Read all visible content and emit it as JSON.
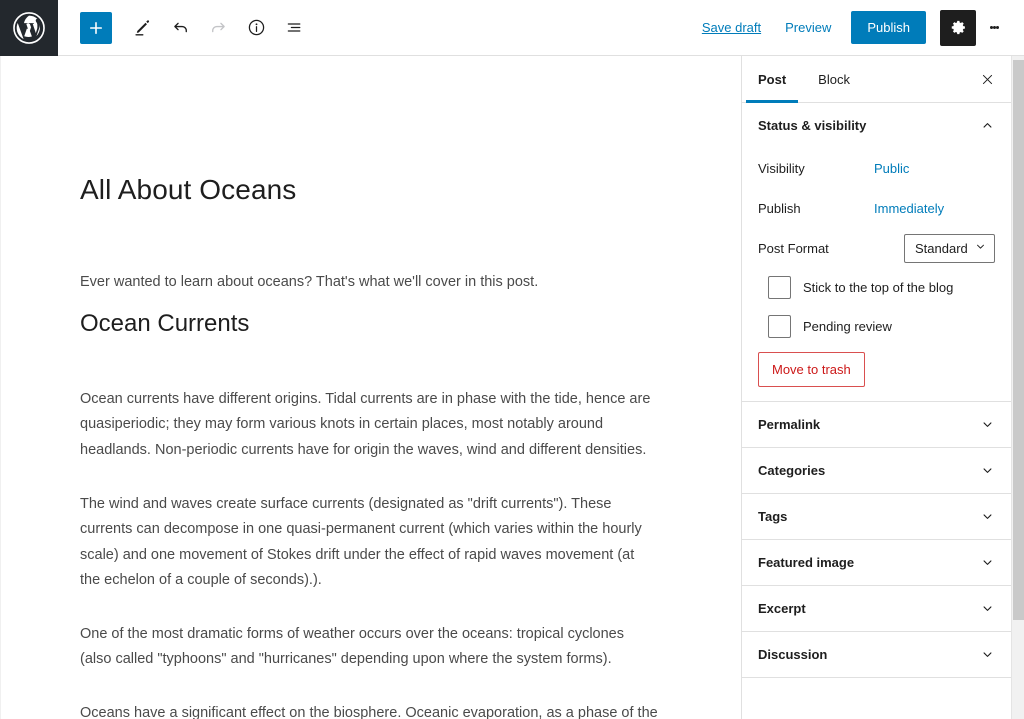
{
  "header": {
    "logo_icon": "wordpress-logo-icon",
    "tools": [
      {
        "name": "add-block-button",
        "icon": "plus-icon",
        "label": "Add block",
        "state": "primary"
      },
      {
        "name": "edit-mode-button",
        "icon": "pencil-icon",
        "label": "Tools",
        "state": "normal"
      },
      {
        "name": "undo-button",
        "icon": "undo-arrow-icon",
        "label": "Undo",
        "state": "normal"
      },
      {
        "name": "redo-button",
        "icon": "redo-arrow-icon",
        "label": "Redo",
        "state": "disabled"
      },
      {
        "name": "details-button",
        "icon": "info-circle-icon",
        "label": "Details",
        "state": "normal"
      },
      {
        "name": "list-view-button",
        "icon": "list-view-icon",
        "label": "List view",
        "state": "normal"
      }
    ],
    "save_draft_label": "Save draft",
    "preview_label": "Preview",
    "publish_label": "Publish",
    "settings_icon": "gear-icon",
    "options_icon": "kebab-menu-icon"
  },
  "editor": {
    "title": "All About Oceans",
    "blocks": [
      {
        "type": "paragraph",
        "text": "Ever wanted to learn about oceans? That's what we'll cover in this post."
      },
      {
        "type": "heading",
        "text": "Ocean Currents"
      },
      {
        "type": "paragraph",
        "text": "Ocean currents have different origins. Tidal currents are in phase with the tide, hence are quasiperiodic; they may form various knots in certain places, most notably around headlands. Non-periodic currents have for origin the waves, wind and different densities."
      },
      {
        "type": "paragraph",
        "text": "The wind and waves create surface currents (designated as \"drift currents\"). These currents can decompose in one quasi-permanent current (which varies within the hourly scale) and one movement of Stokes drift under the effect of rapid waves movement (at the echelon of a couple of seconds).)."
      },
      {
        "type": "paragraph",
        "text": "One of the most dramatic forms of weather occurs over the oceans: tropical cyclones (also called \"typhoons\" and \"hurricanes\" depending upon where the system forms)."
      },
      {
        "type": "paragraph",
        "text": "Oceans have a significant effect on the biosphere. Oceanic evaporation, as a phase of the"
      }
    ]
  },
  "sidebar": {
    "tabs": [
      {
        "label": "Post",
        "active": true
      },
      {
        "label": "Block",
        "active": false
      }
    ],
    "close_icon": "close-icon",
    "status_panel": {
      "title": "Status & visibility",
      "expanded": true,
      "chevron_icon": "chevron-up-icon",
      "visibility_label": "Visibility",
      "visibility_value": "Public",
      "publish_label": "Publish",
      "publish_value": "Immediately",
      "post_format_label": "Post Format",
      "post_format_value": "Standard",
      "post_format_options": [
        "Standard"
      ],
      "sticky_label": "Stick to the top of the blog",
      "sticky_checked": false,
      "pending_label": "Pending review",
      "pending_checked": false,
      "trash_label": "Move to trash"
    },
    "panels": [
      {
        "title": "Permalink",
        "chevron_icon": "chevron-down-icon"
      },
      {
        "title": "Categories",
        "chevron_icon": "chevron-down-icon"
      },
      {
        "title": "Tags",
        "chevron_icon": "chevron-down-icon"
      },
      {
        "title": "Featured image",
        "chevron_icon": "chevron-down-icon"
      },
      {
        "title": "Excerpt",
        "chevron_icon": "chevron-down-icon"
      },
      {
        "title": "Discussion",
        "chevron_icon": "chevron-down-icon"
      }
    ]
  },
  "colors": {
    "accent": "#007cba",
    "admin_dark": "#23282d",
    "danger": "#cc1818",
    "text": "#1e1e1e",
    "body_text": "#4a4a4a"
  }
}
